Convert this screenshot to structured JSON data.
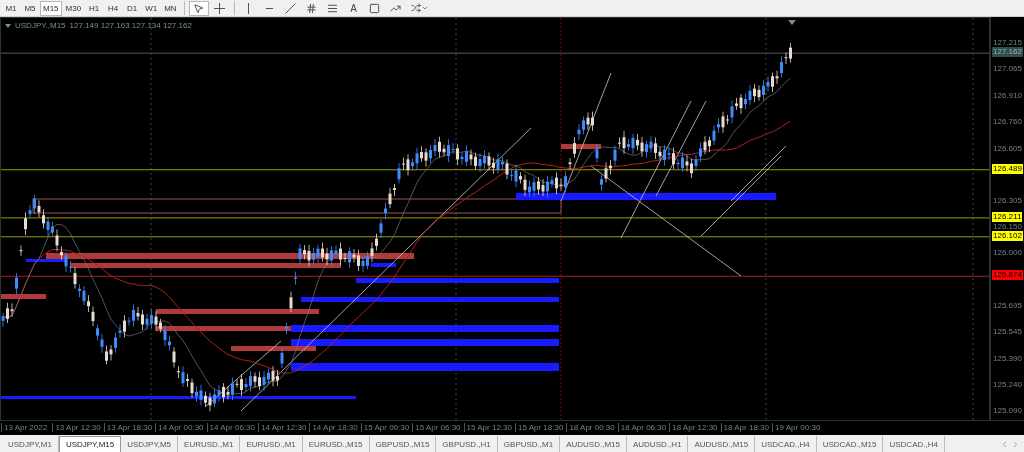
{
  "toolbar": {
    "timeframes": [
      {
        "label": "M1",
        "selected": false
      },
      {
        "label": "M5",
        "selected": false
      },
      {
        "label": "M15",
        "selected": true
      },
      {
        "label": "M30",
        "selected": false
      },
      {
        "label": "H1",
        "selected": false
      },
      {
        "label": "H4",
        "selected": false
      },
      {
        "label": "D1",
        "selected": false
      },
      {
        "label": "W1",
        "selected": false
      },
      {
        "label": "MN",
        "selected": false
      }
    ],
    "text_tool": "A"
  },
  "chart": {
    "symbol": "USDJPY.,M15",
    "quote": "127.149 127.163 127.134 127.162",
    "price_axis": [
      {
        "label": "127.215",
        "kind": "tick"
      },
      {
        "label": "127.162",
        "kind": "marker",
        "color": "#2f4f4f"
      },
      {
        "label": "127.065",
        "kind": "tick"
      },
      {
        "label": "126.910",
        "kind": "tick"
      },
      {
        "label": "126.760",
        "kind": "tick"
      },
      {
        "label": "126.605",
        "kind": "tick"
      },
      {
        "label": "126.489",
        "kind": "marker",
        "color": "#ffff00"
      },
      {
        "label": "126.305",
        "kind": "tick"
      },
      {
        "label": "126.211",
        "kind": "marker",
        "color": "#ffff00"
      },
      {
        "label": "126.150",
        "kind": "tick"
      },
      {
        "label": "126.102",
        "kind": "marker",
        "color": "#ffff00"
      },
      {
        "label": "126.000",
        "kind": "tick"
      },
      {
        "label": "125.874",
        "kind": "marker",
        "color": "#ff0000"
      },
      {
        "label": "125.695",
        "kind": "tick"
      },
      {
        "label": "125.545",
        "kind": "tick"
      },
      {
        "label": "125.390",
        "kind": "tick"
      },
      {
        "label": "125.240",
        "kind": "tick"
      },
      {
        "label": "125.090",
        "kind": "tick"
      }
    ],
    "time_axis": [
      "13 Apr 2022",
      "13 Apr 12:30",
      "13 Apr 18:30",
      "14 Apr 00:30",
      "14 Apr 06:30",
      "14 Apr 12:30",
      "14 Apr 18:30",
      "15 Apr 00:30",
      "15 Apr 06:30",
      "15 Apr 12:30",
      "15 Apr 18:30",
      "18 Apr 00:30",
      "18 Apr 06:30",
      "18 Apr 12:30",
      "18 Apr 18:30",
      "19 Apr 00:30"
    ]
  },
  "tabs": [
    {
      "label": "USDJPY,M1",
      "selected": false
    },
    {
      "label": "USDJPY,M15",
      "selected": true
    },
    {
      "label": "USDJPY,M5",
      "selected": false
    },
    {
      "label": "EURUSD.,M1",
      "selected": false
    },
    {
      "label": "EURUSD.,M1",
      "selected": false
    },
    {
      "label": "EURUSD.,M15",
      "selected": false
    },
    {
      "label": "GBPUSD.,M15",
      "selected": false
    },
    {
      "label": "GBPUSD.,H1",
      "selected": false
    },
    {
      "label": "GBPUSD.,M1",
      "selected": false
    },
    {
      "label": "AUDUSD.,M15",
      "selected": false
    },
    {
      "label": "AUDUSD.,H1",
      "selected": false
    },
    {
      "label": "AUDUSD.,M15",
      "selected": false
    },
    {
      "label": "USDCAD.,H4",
      "selected": false
    },
    {
      "label": "USDCAD.,M15",
      "selected": false
    },
    {
      "label": "USDCAD.,H4",
      "selected": false
    }
  ]
}
